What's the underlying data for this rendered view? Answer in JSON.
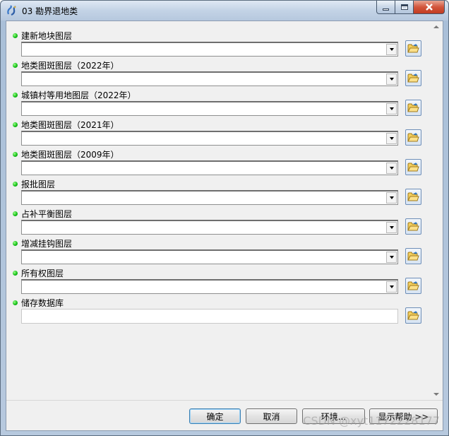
{
  "window": {
    "title": "03 勘界退地类",
    "icon": "python-script-icon"
  },
  "fields": [
    {
      "label": "建新地块图层",
      "type": "combo",
      "value": ""
    },
    {
      "label": "地类图斑图层（2022年）",
      "type": "combo",
      "value": ""
    },
    {
      "label": "城镇村等用地图层（2022年）",
      "type": "combo",
      "value": ""
    },
    {
      "label": "地类图斑图层（2021年）",
      "type": "combo",
      "value": ""
    },
    {
      "label": "地类图斑图层（2009年）",
      "type": "combo",
      "value": ""
    },
    {
      "label": "报批图层",
      "type": "combo",
      "value": ""
    },
    {
      "label": "占补平衡图层",
      "type": "combo",
      "value": ""
    },
    {
      "label": "增减挂钩图层",
      "type": "combo",
      "value": ""
    },
    {
      "label": "所有权图层",
      "type": "combo",
      "value": ""
    },
    {
      "label": "储存数据库",
      "type": "text",
      "value": ""
    }
  ],
  "buttons": {
    "ok": "确定",
    "cancel": "取消",
    "environments": "环境...",
    "show_help": "显示帮助 >>"
  },
  "watermark": "CSDN @xyt1172228177",
  "colors": {
    "required_dot": "#17c21a",
    "client_bg": "#f0f0f0",
    "titlebar": "#c3d3e6",
    "close_button": "#d2553c"
  }
}
